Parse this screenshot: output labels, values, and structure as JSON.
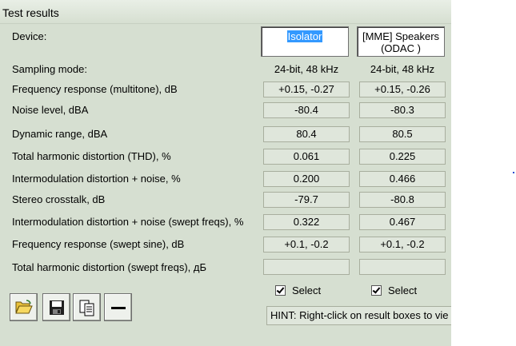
{
  "window": {
    "title": "Test results"
  },
  "labels": {
    "device": "Device:",
    "sampling": "Sampling mode:",
    "freq_multitone": "Frequency response (multitone), dB",
    "noise": "Noise level, dBA",
    "dynamic_range": "Dynamic range, dBA",
    "thd": "Total harmonic distortion (THD), %",
    "imd": "Intermodulation distortion + noise, %",
    "crosstalk": "Stereo crosstalk, dB",
    "imd_swept": "Intermodulation distortion + noise (swept freqs), %",
    "freq_swept": "Frequency response (swept sine), dB",
    "thd_swept": "Total harmonic distortion (swept freqs), дБ"
  },
  "device1": {
    "name": "Isolator",
    "sampling": "24-bit, 48 kHz",
    "freq_multitone": "+0.15, -0.27",
    "noise": "-80.4",
    "dynamic_range": "80.4",
    "thd": "0.061",
    "imd": "0.200",
    "crosstalk": "-79.7",
    "imd_swept": "0.322",
    "freq_swept": "+0.1, -0.2",
    "thd_swept": "",
    "select_label": "Select"
  },
  "device2": {
    "name_line1": "[MME] Speakers",
    "name_line2": "(ODAC )",
    "sampling": "24-bit, 48 kHz",
    "freq_multitone": "+0.15, -0.26",
    "noise": "-80.3",
    "dynamic_range": "80.5",
    "thd": "0.225",
    "imd": "0.466",
    "crosstalk": "-80.8",
    "imd_swept": "0.467",
    "freq_swept": "+0.1, -0.2",
    "thd_swept": "",
    "select_label": "Select"
  },
  "hint": "HINT: Right-click on result boxes to vie",
  "toolbar": {
    "open_icon": "folder-open-icon",
    "save_icon": "floppy-disk-icon",
    "copy_icon": "copy-pages-icon",
    "remove_icon": "minus-icon"
  }
}
